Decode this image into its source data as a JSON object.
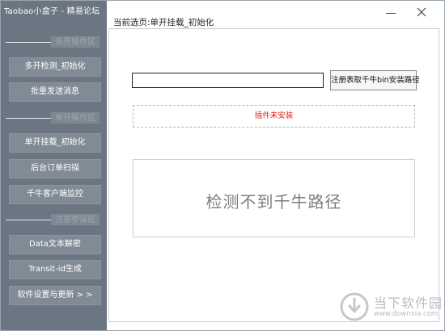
{
  "app": {
    "title": "Taobao小盒子 - 精易论坛"
  },
  "sidebar": {
    "sections": [
      {
        "label": "多开操作区"
      },
      {
        "label": "单开操作区"
      },
      {
        "label": "注意参谋区"
      }
    ],
    "buttons": [
      {
        "label": "多开检测_初始化"
      },
      {
        "label": "批量发送消息"
      },
      {
        "label": "单开挂载_初始化"
      },
      {
        "label": "后台订单扫描"
      },
      {
        "label": "千牛客户端监控"
      },
      {
        "label": "Data文本解密"
      },
      {
        "label": "Transit-id生成"
      },
      {
        "label": "软件设置与更新 > >"
      }
    ]
  },
  "main": {
    "page_title": "当前选页:单开挂载_初始化",
    "path_input": {
      "value": "",
      "placeholder": ""
    },
    "read_button": "注册表取千牛bin安装路径",
    "plugin_status": "插件未安装",
    "detect_message": "检测不到千牛路径"
  },
  "watermark": {
    "name": "当下软件园",
    "url": "www.downxia.com"
  },
  "colors": {
    "sidebar_bg": "#6b7682",
    "button_bg": "#818b96",
    "status_red": "#e02020"
  },
  "icons": {
    "minimize": "minimize-icon",
    "close": "close-icon",
    "watermark_logo": "downxia-logo-icon"
  }
}
